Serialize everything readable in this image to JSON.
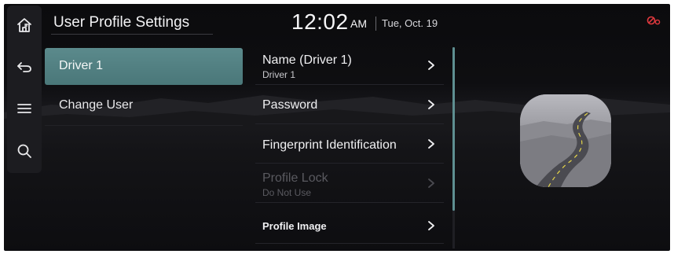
{
  "header": {
    "title": "User Profile Settings",
    "time": "12:02",
    "ampm": "AM",
    "date": "Tue, Oct. 19",
    "status_icon": "connectivity-off-icon",
    "status_color": "#e0393e"
  },
  "rail": {
    "items": [
      {
        "icon": "home-icon"
      },
      {
        "icon": "back-icon"
      },
      {
        "icon": "menu-icon"
      },
      {
        "icon": "search-icon"
      }
    ]
  },
  "users": {
    "active": "Driver 1",
    "change": "Change User"
  },
  "settings": {
    "items": [
      {
        "label": "Name (Driver 1)",
        "sub": "Driver 1",
        "enabled": true
      },
      {
        "label": "Password",
        "enabled": true
      },
      {
        "label": "Fingerprint Identification",
        "enabled": true
      },
      {
        "label": "Profile Lock",
        "sub": "Do Not Use",
        "enabled": false
      },
      {
        "label": "Profile Image",
        "enabled": true
      }
    ]
  },
  "colors": {
    "accent": "#5b8a8c",
    "background": "#0e0e11"
  }
}
